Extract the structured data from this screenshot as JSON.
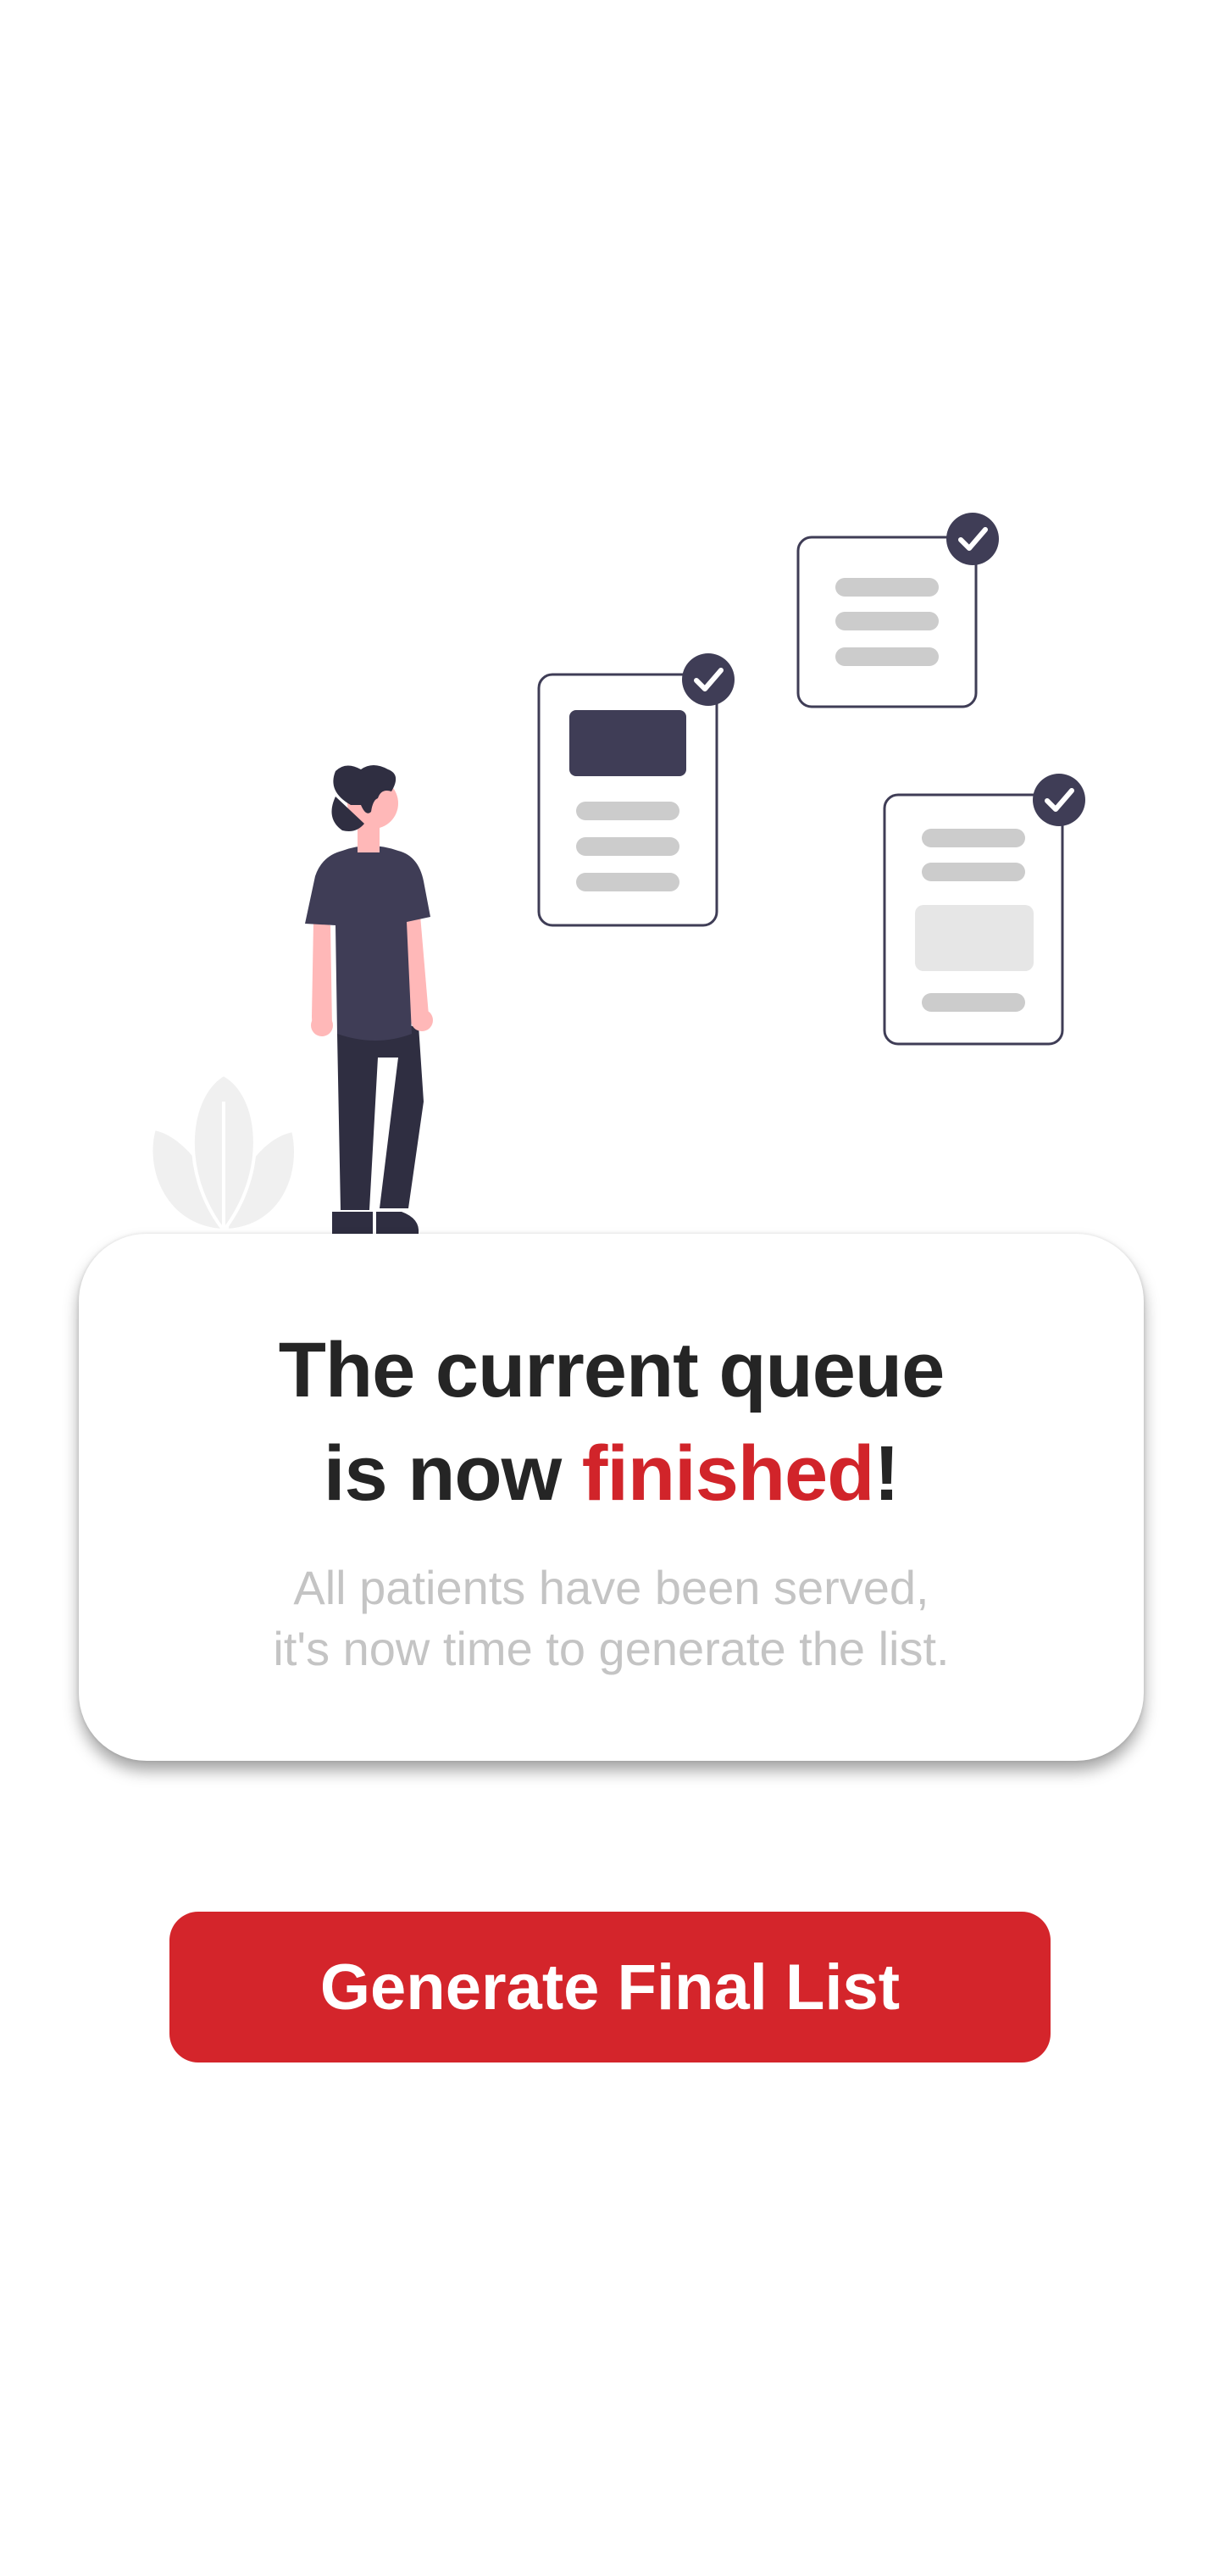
{
  "colors": {
    "accent": "#d1242a",
    "button": "#d4252b",
    "title_text": "#252525",
    "subtitle_text": "#c4c4c4",
    "illustration_dark": "#3f3d56",
    "illustration_skin": "#ffb8b8"
  },
  "card": {
    "title_line1": "The current queue",
    "title_line2_prefix": "is now ",
    "title_highlight": "finished",
    "title_suffix": "!",
    "subtitle_line1": "All patients have been served,",
    "subtitle_line2": "it's now time to generate the list."
  },
  "actions": {
    "generate_label": "Generate Final List"
  },
  "illustration": {
    "icons": [
      "person-figure",
      "plant-leaf-icon",
      "document-icon",
      "check-badge-icon"
    ]
  }
}
